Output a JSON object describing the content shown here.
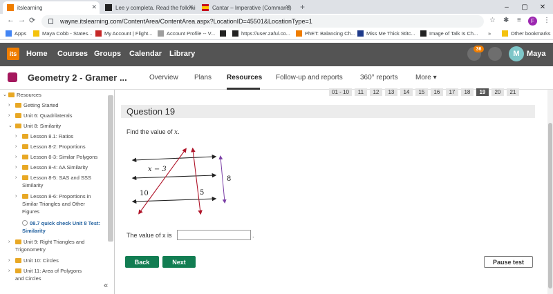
{
  "browser": {
    "tabs": [
      {
        "title": "itslearning",
        "active": true
      },
      {
        "title": "Lee y completa. Read the followi",
        "active": false
      },
      {
        "title": "Cantar – Imperative (Command) |",
        "active": false
      }
    ],
    "new_tab": "+",
    "window": {
      "minimize": "–",
      "maximize": "▢",
      "close": "✕"
    },
    "url": "wayne.itslearning.com/ContentArea/ContentArea.aspx?LocationID=45501&LocationType=1",
    "profile_initial": "F",
    "bookmarks": [
      {
        "label": "Apps",
        "color": "#4285f4"
      },
      {
        "label": "Maya Cobb - States...",
        "color": "#f4c20d"
      },
      {
        "label": "My Account | Flight...",
        "color": "#c62828"
      },
      {
        "label": "Account Profile -- V...",
        "color": "#9e9e9e"
      },
      {
        "label": "",
        "color": "#222222"
      },
      {
        "label": "https://user.zaful.co...",
        "color": "#222222"
      },
      {
        "label": "PhET: Balancing Ch...",
        "color": "#ef7d00"
      },
      {
        "label": "Miss Me Thick Stitc...",
        "color": "#1e3a8a"
      },
      {
        "label": "Image of Talk Is Ch...",
        "color": "#222222"
      },
      {
        "label": "»",
        "color": ""
      },
      {
        "label": "Other bookmarks",
        "color": "#f4c20d"
      }
    ]
  },
  "itslearning": {
    "logo": "its",
    "nav": [
      "Home",
      "Courses",
      "Groups",
      "Calendar",
      "Library"
    ],
    "notification_count": "36",
    "user_initial": "M",
    "user_name": "Maya",
    "accent": "#ef7d00"
  },
  "course": {
    "title": "Geometry 2 - Gramer ...",
    "tabs": [
      "Overview",
      "Plans",
      "Resources",
      "Follow-up and reports",
      "360° reports",
      "More"
    ],
    "active_tab": "Resources"
  },
  "sidebar": {
    "items": [
      {
        "label": "Resources",
        "level": 0,
        "expanded": true
      },
      {
        "label": "Getting Started",
        "level": 1
      },
      {
        "label": "Unit 6: Quadrilaterals",
        "level": 1
      },
      {
        "label": "Unit 8: Similarity",
        "level": 1,
        "expanded": true
      },
      {
        "label": "Lesson 8.1: Ratios",
        "level": 2
      },
      {
        "label": "Lesson 8-2: Proportions",
        "level": 2
      },
      {
        "label": "Lesson 8-3: Similar Polygons",
        "level": 2
      },
      {
        "label": "Lesson 8-4: AA Similarity",
        "level": 2
      },
      {
        "label": "Lesson 8-5: SAS and SSS Similarity",
        "level": 2
      },
      {
        "label": "Lesson 8-6: Proportions in Similar Triangles and Other Figures",
        "level": 2
      },
      {
        "label": "08.7 quick check Unit 8 Test: Similarity",
        "level": 2,
        "current": true
      },
      {
        "label": "Unit 9: Right Triangles and Trigonometry",
        "level": 1
      },
      {
        "label": "Unit 10: Circles",
        "level": 1
      },
      {
        "label": "Unit 11: Area of Polygons and Circles",
        "level": 1
      }
    ],
    "collapse": "«"
  },
  "test": {
    "pages": [
      "01 - 10",
      "11",
      "12",
      "13",
      "14",
      "15",
      "16",
      "17",
      "18",
      "19",
      "20",
      "21"
    ],
    "current_page": "19",
    "question_title": "Question 19",
    "prompt_text": "Find the value of ",
    "prompt_var": "x",
    "prompt_end": ".",
    "figure_labels": {
      "top": "x − 3",
      "left": "10",
      "mid": "5",
      "right": "8"
    },
    "answer_label": "The value of x is",
    "answer_value": "",
    "answer_end": ".",
    "back": "Back",
    "next": "Next",
    "pause": "Pause test",
    "button_green": "#127d52"
  }
}
